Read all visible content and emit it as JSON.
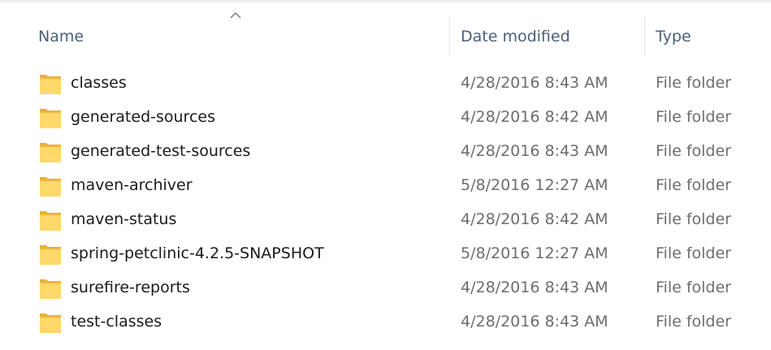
{
  "columns": {
    "name": "Name",
    "date_modified": "Date modified",
    "type": "Type",
    "sort_indicator": "chevron-up-icon"
  },
  "colors": {
    "header_text": "#4c607a",
    "folder_body": "#ffd86b",
    "folder_back": "#e8b339",
    "date_text": "#6d6d6d"
  },
  "files": [
    {
      "name": "classes",
      "date": "4/28/2016 8:43 AM",
      "type": "File folder",
      "icon": "folder-icon"
    },
    {
      "name": "generated-sources",
      "date": "4/28/2016 8:42 AM",
      "type": "File folder",
      "icon": "folder-icon"
    },
    {
      "name": "generated-test-sources",
      "date": "4/28/2016 8:43 AM",
      "type": "File folder",
      "icon": "folder-icon"
    },
    {
      "name": "maven-archiver",
      "date": "5/8/2016 12:27 AM",
      "type": "File folder",
      "icon": "folder-icon"
    },
    {
      "name": "maven-status",
      "date": "4/28/2016 8:42 AM",
      "type": "File folder",
      "icon": "folder-icon"
    },
    {
      "name": "spring-petclinic-4.2.5-SNAPSHOT",
      "date": "5/8/2016 12:27 AM",
      "type": "File folder",
      "icon": "folder-icon"
    },
    {
      "name": "surefire-reports",
      "date": "4/28/2016 8:43 AM",
      "type": "File folder",
      "icon": "folder-icon"
    },
    {
      "name": "test-classes",
      "date": "4/28/2016 8:43 AM",
      "type": "File folder",
      "icon": "folder-icon"
    }
  ]
}
